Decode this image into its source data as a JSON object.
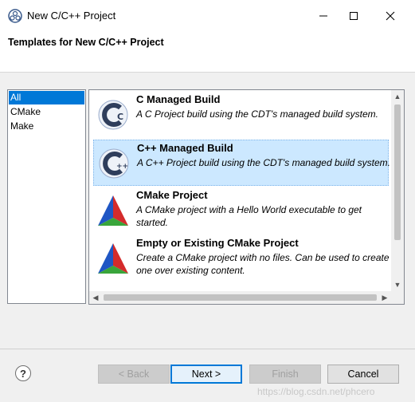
{
  "window": {
    "title": "New C/C++ Project"
  },
  "header": {
    "title": "Templates for New C/C++ Project"
  },
  "categories": [
    {
      "label": "All",
      "selected": true
    },
    {
      "label": "CMake",
      "selected": false
    },
    {
      "label": "Make",
      "selected": false
    }
  ],
  "templates": [
    {
      "title": "C Managed Build",
      "description": "A C Project build using the CDT's managed build system.",
      "icon": "cdt-c-icon"
    },
    {
      "title": "C++ Managed Build",
      "description": "A C++ Project build using the CDT's managed build system.",
      "icon": "cdt-cpp-icon",
      "selected": true
    },
    {
      "title": "CMake Project",
      "description": "A CMake project with a Hello World executable to get started.",
      "icon": "cmake-icon"
    },
    {
      "title": "Empty or Existing CMake Project",
      "description": "Create a CMake project with no files. Can be used to create one over existing content.",
      "icon": "cmake-icon"
    }
  ],
  "buttons": {
    "help": "?",
    "back": "< Back",
    "next": "Next >",
    "finish": "Finish",
    "cancel": "Cancel"
  },
  "watermark": "https://blog.csdn.net/phcero"
}
